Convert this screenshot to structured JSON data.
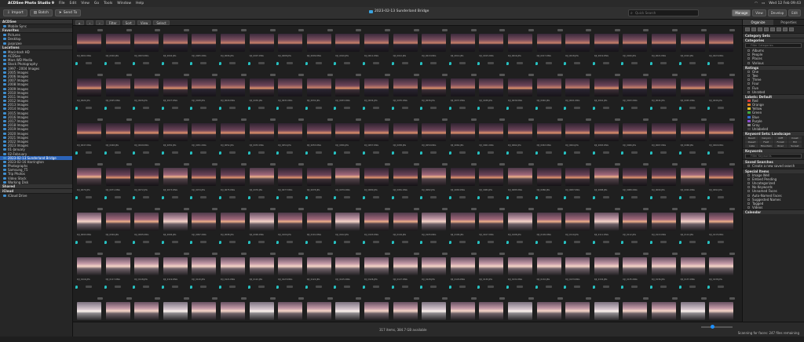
{
  "menubar": {
    "app_name": "ACDSee Photo Studio 9",
    "items": [
      "File",
      "Edit",
      "View",
      "Go",
      "Tools",
      "Window",
      "Help"
    ],
    "datetime": "Wed 12 Feb  09:43"
  },
  "toolbar": {
    "import_label": "Import",
    "batch_label": "Batch",
    "send_label": "Send To",
    "window_title": "2023-02-13 Sunderland Bridge",
    "search_placeholder": "Quick Search",
    "modes": [
      "Manage",
      "View",
      "Develop",
      "Edit"
    ],
    "active_mode": "Manage"
  },
  "sidebar": {
    "sections": [
      {
        "title": "ACDSee",
        "items": [
          "Mobile Sync"
        ]
      },
      {
        "title": "Favorites",
        "items": [
          "Pictures",
          "Desktop",
          "jasonzee"
        ]
      },
      {
        "title": "Locations",
        "items": [
          "Macintosh HD",
          "ACDSee",
          "Mars WD Media",
          "Stock Photography",
          "1997 - 2004 Images",
          "2005 Images",
          "2006 Images",
          "2007 Images",
          "2008 Images",
          "2009 Images",
          "2010 Images",
          "2011 Images",
          "2012 Images",
          "2013 Images",
          "2014 Images",
          "2015 Images",
          "2016 Images",
          "2017 Images",
          "2018 Images",
          "2019 Images",
          "2020 Images",
          "2021 Images",
          "2022 Images",
          "2023 Images",
          "01-January",
          "02-February",
          "2023-02-13 Sunderland Bridge",
          "2023-02-16 Harrington",
          "Photographs",
          "Samsung_T5",
          "Trip Photos",
          "Video Stock",
          "Working Disk"
        ]
      },
      {
        "title": "Shared",
        "items": []
      },
      {
        "title": "iCloud",
        "items": [
          "iCloud Drive"
        ]
      }
    ],
    "selected_item": "2023-02-13 Sunderland Bridge"
  },
  "filterbar": {
    "filter_label": "Filter",
    "sort_label": "Sort",
    "view_label": "View",
    "select_label": "Select"
  },
  "grid": {
    "rows": [
      [
        "DJI_0001.DNG",
        "DJI_0002.JPG",
        "DJI_0003.DNG",
        "DJI_0004.JPG",
        "DJI_0005.DNG",
        "DJI_0006.JPG",
        "DJI_0007.DNG",
        "DJI_0008.JPG",
        "DJI_0009.DNG",
        "DJI_0010.JPG",
        "DJI_0011.DNG",
        "DJI_0012.JPG",
        "DJI_0013.DNG",
        "DJI_0014.JPG",
        "DJI_0015.DNG",
        "DJI_0016.JPG",
        "DJI_0017.DNG",
        "DJI_0018.JPG",
        "DJI_0019.DNG",
        "DJI_0020.JPG",
        "DJI_0021.DNG",
        "DJI_0022.JPG",
        "DJI_0023.DNG"
      ],
      [
        "DJI_0024.JPG",
        "DJI_0025.DNG",
        "DJI_0026.JPG",
        "DJI_0027.DNG",
        "DJI_0028.JPG",
        "DJI_0029.DNG",
        "DJI_0030.JPG",
        "DJI_0031.DNG",
        "DJI_0032.JPG",
        "DJI_0033.DNG",
        "DJI_0034.JPG",
        "DJI_0035.DNG",
        "DJI_0036.JPG",
        "DJI_0037.DNG",
        "DJI_0038.JPG",
        "DJI_0039.DNG",
        "DJI_0040.JPG",
        "DJI_0041.DNG",
        "DJI_0042.JPG",
        "DJI_0043.DNG",
        "DJI_0044.JPG",
        "DJI_0045.DNG",
        "DJI_0046.JPG"
      ],
      [
        "DJI_0047.DNG",
        "DJI_0048.JPG",
        "DJI_0049.DNG",
        "DJI_0050.JPG",
        "DJI_0051.DNG",
        "DJI_0052.JPG",
        "DJI_0053.DNG",
        "DJI_0054.JPG",
        "DJI_0055.DNG",
        "DJI_0056.JPG",
        "DJI_0057.DNG",
        "DJI_0058.JPG",
        "DJI_0059.DNG",
        "DJI_0060.JPG",
        "DJI_0061.DNG",
        "DJI_0062.JPG",
        "DJI_0063.DNG",
        "DJI_0064.JPG",
        "DJI_0065.DNG",
        "DJI_0066.JPG",
        "DJI_0067.DNG",
        "DJI_0068.JPG",
        "DJI_0069.DNG"
      ],
      [
        "DJI_0070.JPG",
        "DJI_0071.DNG",
        "DJI_0072.JPG",
        "DJI_0073.DNG",
        "DJI_0074.JPG",
        "DJI_0075.DNG",
        "DJI_0076.JPG",
        "DJI_0077.DNG",
        "DJI_0078.JPG",
        "DJI_0079.DNG",
        "DJI_0080.JPG",
        "DJI_0081.DNG",
        "DJI_0082.JPG",
        "DJI_0083.DNG",
        "DJI_0084.JPG",
        "DJI_0085.DNG",
        "DJI_0086.JPG",
        "DJI_0087.DNG",
        "DJI_0088.JPG",
        "DJI_0089.DNG",
        "DJI_0090.JPG",
        "DJI_0091.DNG",
        "DJI_0092.JPG"
      ],
      [
        "DJI_0093.DNG",
        "DJI_0094.JPG",
        "DJI_0095.DNG",
        "DJI_0096.JPG",
        "DJI_0097.DNG",
        "DJI_0098.JPG",
        "DJI_0099.DNG",
        "DJI_0100.JPG",
        "DJI_0101.DNG",
        "DJI_0102.JPG",
        "DJI_0103.DNG",
        "DJI_0104.JPG",
        "DJI_0105.DNG",
        "DJI_0106.JPG",
        "DJI_0107.DNG",
        "DJI_0108.JPG",
        "DJI_0109.DNG",
        "DJI_0110.JPG",
        "DJI_0111.DNG",
        "DJI_0112.JPG",
        "DJI_0113.DNG",
        "DJI_0114.JPG",
        "DJI_0115.DNG"
      ],
      [
        "DJI_0116.JPG",
        "DJI_0117.DNG",
        "DJI_0118.JPG",
        "DJI_0119.DNG",
        "DJI_0120.JPG",
        "DJI_0121.DNG",
        "DJI_0122.JPG",
        "DJI_0123.DNG",
        "DJI_0124.JPG",
        "DJI_0125.DNG",
        "DJI_0126.JPG",
        "DJI_0127.DNG",
        "DJI_0128.JPG",
        "DJI_0129.DNG",
        "DJI_0130.JPG",
        "DJI_0131.DNG",
        "DJI_0132.JPG",
        "DJI_0133.DNG",
        "DJI_0134.JPG",
        "DJI_0135.DNG",
        "DJI_0136.JPG",
        "DJI_0137.DNG",
        "DJI_0138.JPG"
      ],
      [
        "DJI_0139.DNG",
        "DJI_0140.JPG",
        "DJI_0141.DNG",
        "DJI_0142.JPG",
        "DJI_0143.DNG",
        "DJI_0144.JPG",
        "DJI_0145.DNG",
        "DJI_0146.JPG",
        "DJI_0147.DNG",
        "DJI_0148.JPG",
        "DJI_0149.DNG",
        "DJI_0150.JPG",
        "DJI_0151.DNG",
        "DJI_0152.JPG",
        "DJI_0153.DNG",
        "DJI_0154.JPG",
        "DJI_0155.DNG",
        "DJI_0156.JPG",
        "DJI_0157.DNG",
        "DJI_0158.JPG",
        "DJI_0159.DNG",
        "DJI_0160.JPG",
        "DJI_0161.DNG"
      ]
    ]
  },
  "statusbar": {
    "center_text": "317 items, 384.7 GB available",
    "right_text": "Scanning for faces: 247 files remaining"
  },
  "rightpanel": {
    "tabs": [
      "Organize",
      "Properties"
    ],
    "active_tab": "Organize",
    "sections": [
      {
        "title": "Category Sets",
        "items": []
      },
      {
        "title": "Categories",
        "filter": "Filter Categories",
        "items": [
          "Albums",
          "People",
          "Places",
          "Various"
        ]
      },
      {
        "title": "Ratings",
        "items": [
          "One",
          "Two",
          "Three",
          "Four",
          "Five",
          "Unrated"
        ]
      },
      {
        "title": "Labels: Default",
        "items": [
          "Red",
          "Orange",
          "Yellow",
          "Green",
          "Blue",
          "Purple",
          "Gray",
          "Unlabeled"
        ]
      },
      {
        "title": "Keyword Sets: Landscape",
        "items": []
      },
      {
        "title": "Keywords",
        "filter": "Filter Keywords",
        "items": []
      },
      {
        "title": "Saved Searches",
        "items": [
          "Create a new saved search"
        ]
      },
      {
        "title": "Special Items",
        "items": [
          "Image Well",
          "Embed Pending",
          "Uncategorized",
          "No Keywords",
          "Unnamed Faces",
          "Auto-Named Faces",
          "Suggested Names",
          "Tagged",
          "Videos"
        ]
      },
      {
        "title": "Calendar",
        "items": []
      }
    ],
    "keyword_grid": [
      "Beach",
      "Canyon",
      "Cliff",
      "Coast",
      "Desert",
      "Field",
      "Forest",
      "Hill",
      "Lake",
      "Mountain",
      "River",
      "Sunset"
    ],
    "label_colors": [
      "#d23b3b",
      "#e07a22",
      "#e0c322",
      "#3faa3f",
      "#2f6fd6",
      "#8a4ccf",
      "#8a8a8a",
      "#444444"
    ]
  },
  "thumb_gradients": [
    "linear-gradient(180deg,#3a2a3c 0%,#7b4e5e 35%,#c9806a 52%,#2a2430 60%,#171419 100%)",
    "linear-gradient(180deg,#2e2330 0%,#6d4459 40%,#e1926c 55%,#3b2e36 63%,#151216 100%)",
    "linear-gradient(180deg,#4d3a4a 0%,#a0677a 38%,#f0b08a 50%,#524249 62%,#1d191c 100%)",
    "linear-gradient(180deg,#665061 0%,#c49aa7 35%,#f7d6c8 50%,#6d5f66 64%,#232023 100%)",
    "linear-gradient(180deg,#7c7280 0%,#d7c7cf 40%,#fff6f0 52%,#8f8a8e 62%,#2c2b2d 100%)"
  ]
}
